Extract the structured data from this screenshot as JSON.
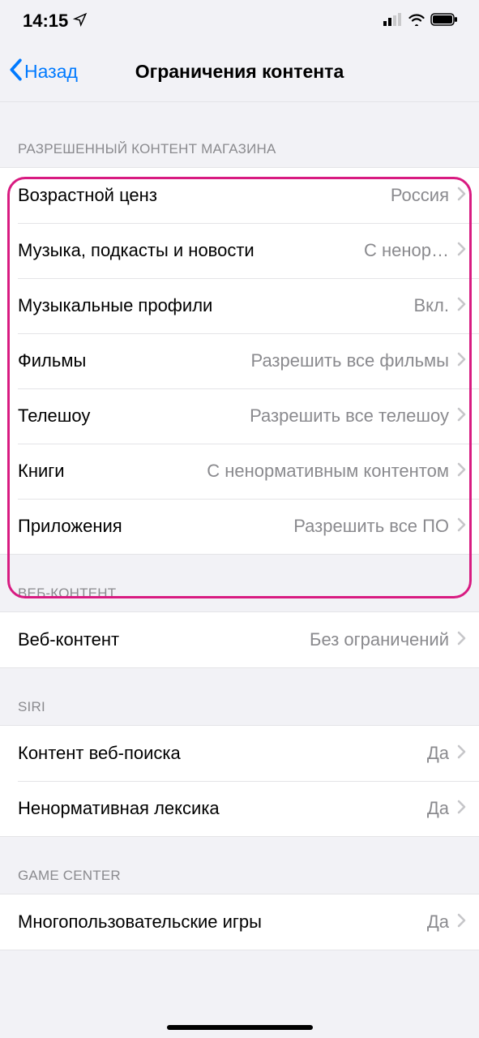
{
  "status": {
    "time": "14:15"
  },
  "nav": {
    "back": "Назад",
    "title": "Ограничения контента"
  },
  "sections": {
    "store": {
      "header": "РАЗРЕШЕННЫЙ КОНТЕНТ МАГАЗИНА",
      "rows": {
        "rating": {
          "label": "Возрастной ценз",
          "value": "Россия"
        },
        "music": {
          "label": "Музыка, подкасты и новости",
          "value": "С ненор…"
        },
        "profiles": {
          "label": "Музыкальные профили",
          "value": "Вкл."
        },
        "films": {
          "label": "Фильмы",
          "value": "Разрешить все фильмы"
        },
        "tv": {
          "label": "Телешоу",
          "value": "Разрешить все телешоу"
        },
        "books": {
          "label": "Книги",
          "value": "С ненормативным контентом"
        },
        "apps": {
          "label": "Приложения",
          "value": "Разрешить все ПО"
        }
      }
    },
    "web": {
      "header": "ВЕБ-КОНТЕНТ",
      "rows": {
        "web": {
          "label": "Веб-контент",
          "value": "Без ограничений"
        }
      }
    },
    "siri": {
      "header": "SIRI",
      "rows": {
        "search": {
          "label": "Контент веб-поиска",
          "value": "Да"
        },
        "profanity": {
          "label": "Ненормативная лексика",
          "value": "Да"
        }
      }
    },
    "gamecenter": {
      "header": "GAME CENTER",
      "rows": {
        "multiplayer": {
          "label": "Многопользовательские игры",
          "value": "Да"
        }
      }
    }
  }
}
